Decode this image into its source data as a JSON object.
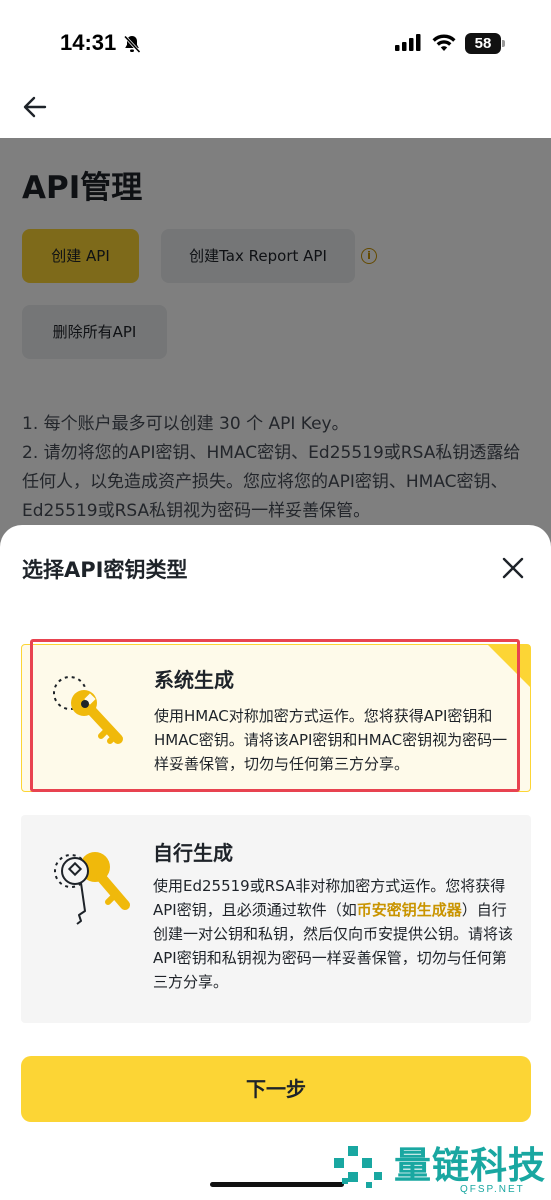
{
  "status_bar": {
    "time": "14:31",
    "battery": "58",
    "icons": [
      "bell-slash-icon",
      "cellular-signal-icon",
      "wifi-icon",
      "battery-icon"
    ]
  },
  "nav": {
    "back_icon": "arrow-left-icon"
  },
  "background_page": {
    "title": "API管理",
    "create_api_label": "创建 API",
    "create_tax_api_label": "创建Tax Report API",
    "delete_all_label": "删除所有API",
    "info_icon": "info-circle-icon",
    "notes": [
      "1. 每个账户最多可以创建 30 个 API Key。",
      "2. 请勿将您的API密钥、HMAC密钥、Ed25519或RSA私钥透露给任何人，以免造成资产损失。您应将您的API密钥、HMAC密钥、Ed25519或RSA私钥视为密码一样妥善保管。"
    ]
  },
  "sheet": {
    "title": "选择API密钥类型",
    "close_icon": "close-icon",
    "options": [
      {
        "title": "系统生成",
        "icon": "key-icon",
        "description": "使用HMAC对称加密方式运作。您将获得API密钥和HMAC密钥。请将该API密钥和HMAC密钥视为密码一样妥善保管，切勿与任何第三方分享。",
        "selected": true
      },
      {
        "title": "自行生成",
        "icon": "key-pair-icon",
        "description_before": "使用Ed25519或RSA非对称加密方式运作。您将获得API密钥，且必须通过软件（如",
        "link_text": "币安密钥生成器",
        "description_after": "）自行创建一对公钥和私钥，然后仅向币安提供公钥。请将该API密钥和私钥视为密码一样妥善保管，切勿与任何第三方分享。",
        "selected": false
      }
    ],
    "next_label": "下一步"
  },
  "watermark": {
    "text": "量链科技",
    "sub": "QFSP.NET"
  },
  "colors": {
    "accent": "#fcd535",
    "link": "#c99400",
    "highlight_box": "#e84350",
    "watermark": "#19a7a1"
  }
}
